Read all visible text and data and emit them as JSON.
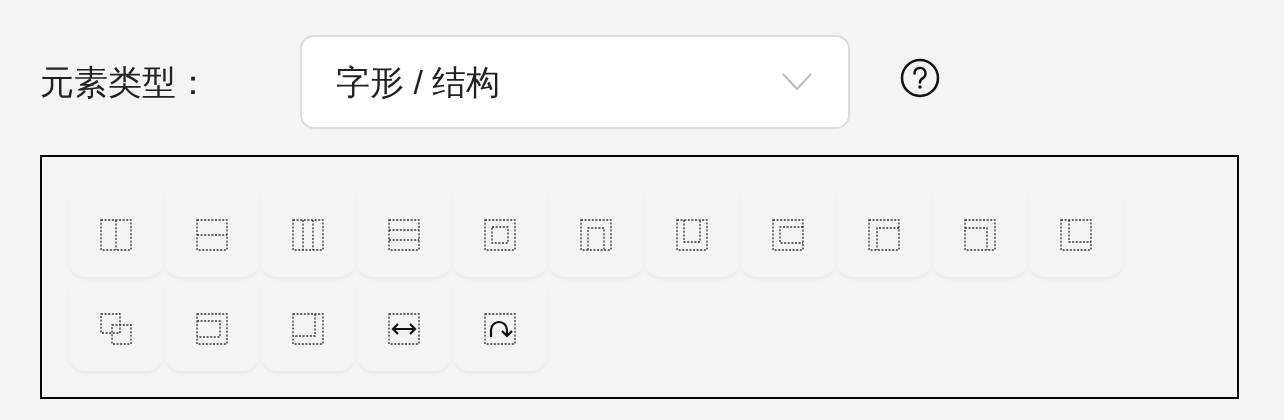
{
  "element_type": {
    "label": "元素类型：",
    "value": "字形 / 结构"
  },
  "palette": {
    "rows": [
      [
        {
          "kind": "lr"
        },
        {
          "kind": "tb"
        },
        {
          "kind": "lmr"
        },
        {
          "kind": "tmb"
        },
        {
          "kind": "surround"
        },
        {
          "kind": "above"
        },
        {
          "kind": "below"
        },
        {
          "kind": "left"
        },
        {
          "kind": "upper-left"
        },
        {
          "kind": "upper-right"
        },
        {
          "kind": "lower-left"
        }
      ],
      [
        {
          "kind": "overlay"
        },
        {
          "kind": "right"
        },
        {
          "kind": "lower-right"
        },
        {
          "kind": "reflect"
        },
        {
          "kind": "rotate"
        }
      ]
    ]
  }
}
